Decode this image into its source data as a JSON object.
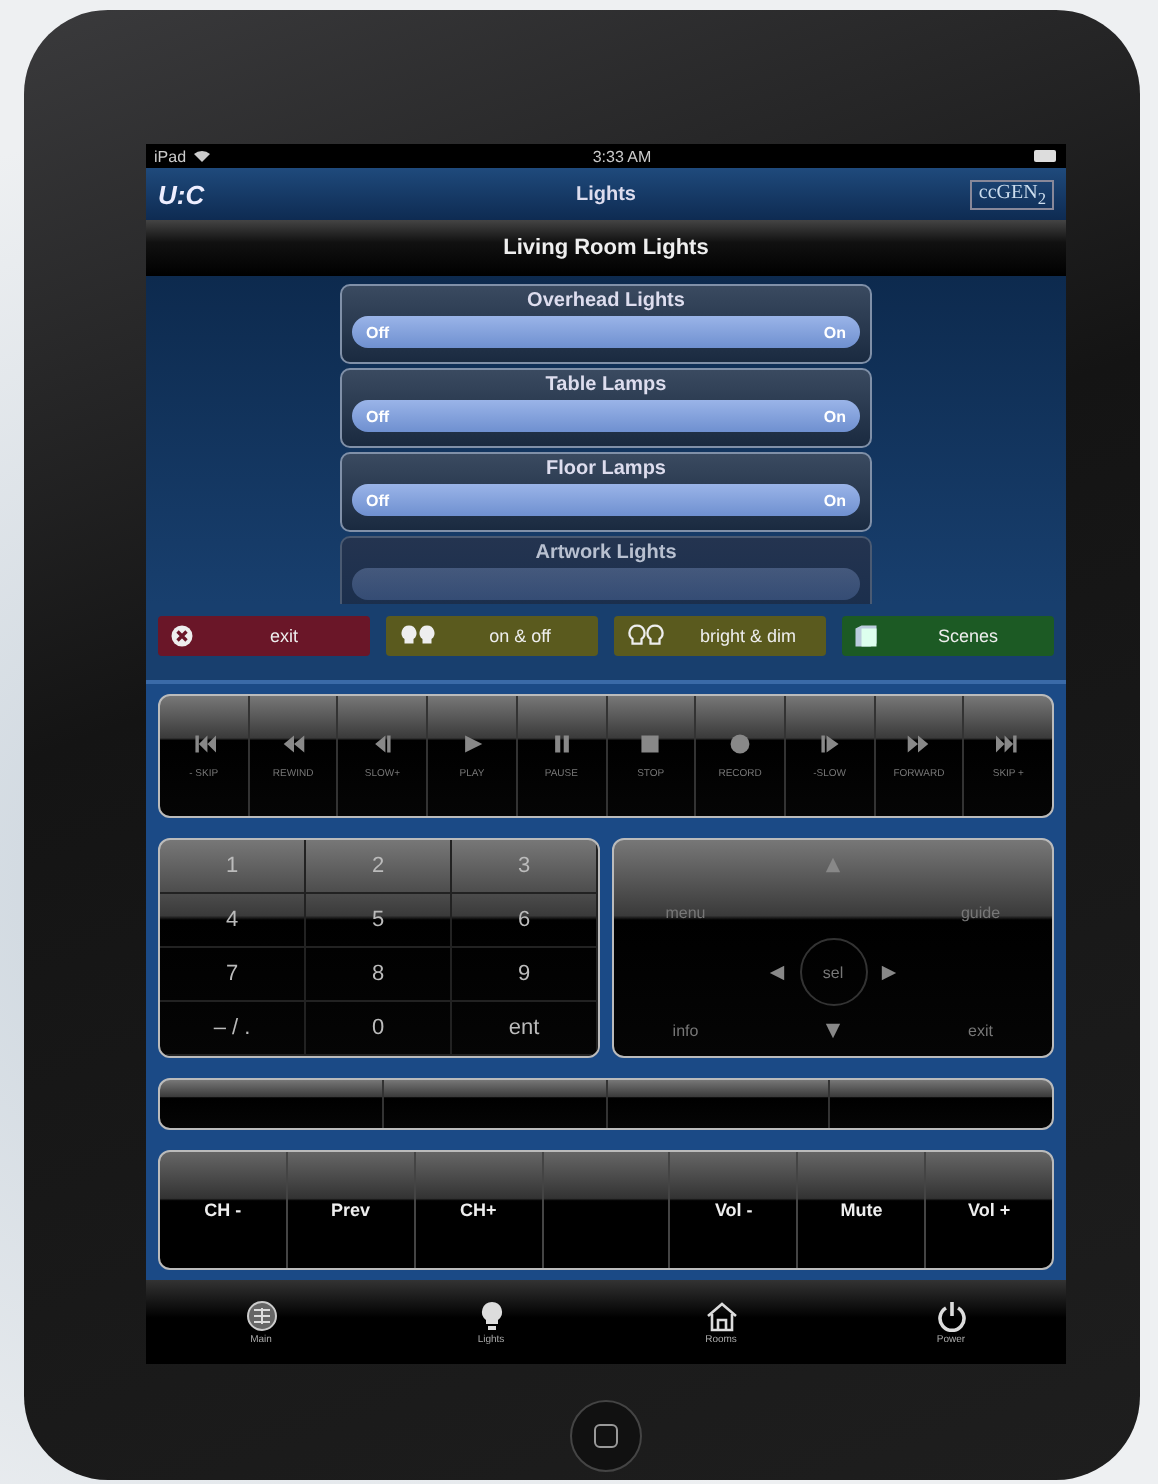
{
  "status_bar": {
    "device": "iPad",
    "time": "3:33 AM"
  },
  "nav_bar": {
    "logo": "U:C",
    "title": "Lights",
    "brand": "ccGEN$_{2}$"
  },
  "section_title": "Living Room Lights",
  "lights": [
    {
      "name": "Overhead Lights",
      "off": "Off",
      "on": "On",
      "faded": false
    },
    {
      "name": "Table Lamps",
      "off": "Off",
      "on": "On",
      "faded": false
    },
    {
      "name": "Floor Lamps",
      "off": "Off",
      "on": "On",
      "faded": false
    },
    {
      "name": "Artwork Lights",
      "faded": true
    }
  ],
  "mode_buttons": [
    {
      "label": "exit",
      "color": "#6a1628"
    },
    {
      "label": "on & off",
      "color": "#5a5a1e"
    },
    {
      "label": "bright & dim",
      "color": "#5a5a1e"
    },
    {
      "label": "Scenes",
      "color": "#1c5a24"
    }
  ],
  "transport": [
    "- SKIP",
    "REWIND",
    "SLOW+",
    "PLAY",
    "PAUSE",
    "STOP",
    "RECORD",
    "-SLOW",
    "FORWARD",
    "SKIP +"
  ],
  "keypad": [
    "1",
    "2",
    "3",
    "4",
    "5",
    "6",
    "7",
    "8",
    "9",
    "– / .",
    "0",
    "ent"
  ],
  "nav_pad": {
    "menu": "menu",
    "guide": "guide",
    "select": "sel",
    "info": "info",
    "exit": "exit"
  },
  "bottom_buttons": [
    {
      "kind": "text",
      "label": "CH -"
    },
    {
      "kind": "text",
      "label": "Prev"
    },
    {
      "kind": "text",
      "label": "CH+"
    },
    {
      "kind": "blank"
    },
    {
      "kind": "text",
      "label": "Vol -"
    },
    {
      "kind": "text",
      "label": "Mute"
    },
    {
      "kind": "text",
      "label": "Vol +"
    }
  ],
  "tab_bar": [
    "Main",
    "Lights",
    "Rooms",
    "Power"
  ]
}
